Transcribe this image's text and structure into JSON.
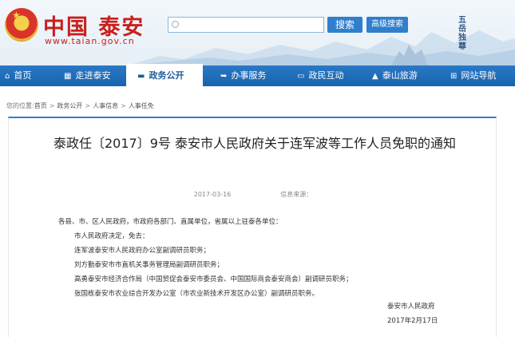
{
  "header": {
    "site_title": "中国 泰安",
    "site_url": "www.taian.gov.cn",
    "search_value": "",
    "search_button": "搜索",
    "advanced_search_button": "高级搜索",
    "seal_text": "五岳独尊"
  },
  "nav": {
    "items": [
      {
        "label": "首页",
        "icon": "home-icon"
      },
      {
        "label": "走进泰安",
        "icon": "city-icon"
      },
      {
        "label": "政务公开",
        "icon": "briefcase-icon",
        "active": true
      },
      {
        "label": "办事服务",
        "icon": "arrow-icon"
      },
      {
        "label": "政民互动",
        "icon": "chat-icon"
      },
      {
        "label": "泰山旅游",
        "icon": "mountain-icon"
      },
      {
        "label": "网站导航",
        "icon": "sitemap-icon"
      }
    ]
  },
  "breadcrumb": {
    "label": "您的位置:",
    "items": [
      "首页",
      "政务公开",
      "人事信息",
      "人事任免"
    ]
  },
  "article": {
    "title": "泰政任〔2017〕9号 泰安市人民政府关于连军波等工作人员免职的通知",
    "date": "2017-03-16",
    "source_label": "信息来源：",
    "salutation": "各县、市、区人民政府，市政府各部门、直属单位，省属以上驻泰各单位：",
    "lines": [
      "市人民政府决定，免去：",
      "连军波泰安市人民政府办公室副调研员职务；",
      "刘方勤泰安市市直机关事务管理局副调研员职务；",
      "高勇泰安市经济合作局（中国贸促会泰安市委员会、中国国际商会泰安商会）副调研员职务；",
      "张国栋泰安市农业综合开发办公室（市农业新技术开发区办公室）副调研员职务。"
    ],
    "signature_org": "泰安市人民政府",
    "signature_date": "2017年2月17日"
  },
  "colors": {
    "brand_red": "#c8201e",
    "nav_blue": "#1e6bb8",
    "button_blue": "#2f7fcd"
  }
}
